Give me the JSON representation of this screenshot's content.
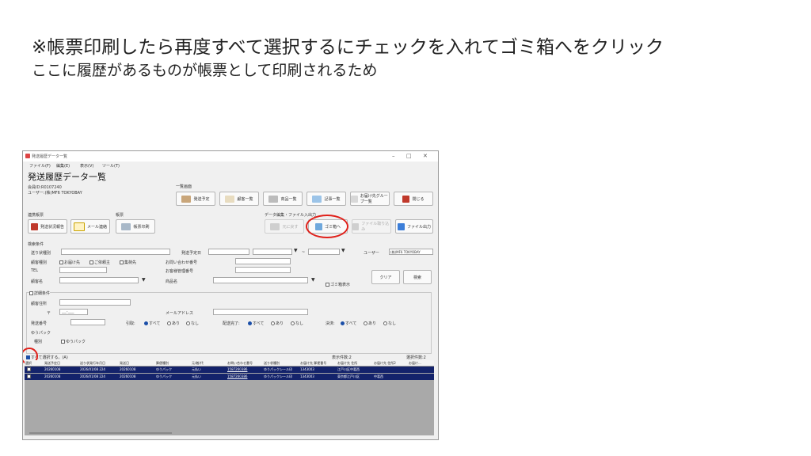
{
  "slide": {
    "line1": "※帳票印刷したら再度すべて選択するにチェックを入れてゴミ箱へをクリック",
    "line2": "ここに履歴があるものが帳票として印刷されるため"
  },
  "window": {
    "title": "発送履歴データ一覧",
    "controls": {
      "minimize": "–",
      "maximize": "□",
      "close": "✕"
    },
    "menu": [
      "ファイル(F)",
      "編集(E)",
      "表示(V)",
      "ツール(T)"
    ],
    "app_title": "発送履歴データ一覧",
    "info1": "会員ID:R0107240",
    "info2": "ユーザー:(株)MF6 TOKYOBAY",
    "list_screen_label": "一覧画面",
    "list_buttons": [
      "発送予定",
      "顧客一覧",
      "商品一覧",
      "記事一覧",
      "お届け先グループ一覧",
      "閉じる"
    ],
    "link_label": "連携帳票",
    "link_buttons": [
      "発送状況報告",
      "メール連絡"
    ],
    "form_label": "帳票",
    "form_button": "帳票印刷",
    "data_ops_label": "データ編集・ファイル入出力",
    "data_buttons": [
      "元に戻す",
      "ゴミ箱へ",
      "ファイル取り込み",
      "ファイル出力"
    ],
    "search_label": "検索条件",
    "fields": {
      "status_type": "送り状種別",
      "acceptance": "発送予定日",
      "tilde": "~",
      "user_label": "ユーザー",
      "user_value": "(株)MF6 TOKYOBAY",
      "customer_type": "顧客種別",
      "cb_delivery": "お届け先",
      "cb_requester": "ご依頼主",
      "cb_shipper": "集荷先",
      "inquiry_no": "お問い合わせ番号",
      "tel": "TEL",
      "cust_mgmt_no": "お客様管理番号",
      "customer_name": "顧客名",
      "product_name": "商品名",
      "show_trash": "ゴミ箱表示",
      "clear_button": "クリア",
      "search_button": "検索"
    },
    "detail": {
      "label": "詳細条件",
      "address": "顧客住所",
      "zip_mark": "〒",
      "zip_value": "___-____",
      "mail": "メールアドレス",
      "ship_no": "発送番号",
      "pickup_label": "引取:",
      "delivered_label": "配送完了:",
      "charge_label": "決済:",
      "opt_all": "すべて",
      "opt_yes": "あり",
      "opt_no": "なし",
      "yupack": "ゆうパック",
      "kind_label": "種別",
      "kind_option": "ゆうパック"
    },
    "grid": {
      "select_all": "すべて選択する。(A)",
      "display_count": "表示件数:2",
      "selected_count": "選択件数:2",
      "columns": [
        "選択",
        "発送予定日",
        "送り状発行年月日",
        "発送日",
        "郵便種別",
        "元/着/代",
        "お問い合わせ番号",
        "送り状種別",
        "お届け先 郵便番号",
        "お届け先 住所",
        "お届け先 住所2",
        "お届け..."
      ],
      "rows": [
        [
          "20260108",
          "2026/01/08 224",
          "20260108",
          "ゆうパック",
          "元払い",
          "1587260386",
          "ゆうパックシール印",
          "1343003",
          "江戸川区中葛西",
          ""
        ],
        [
          "20260108",
          "2026/01/08 224",
          "20260108",
          "ゆうパック",
          "元払い",
          "1587260386",
          "ゆうパックシール印",
          "1343003",
          "東京都江戸川区",
          "中葛西"
        ]
      ]
    }
  },
  "colors": {
    "highlight": "#e0201a",
    "selected_row": "#14236b"
  }
}
